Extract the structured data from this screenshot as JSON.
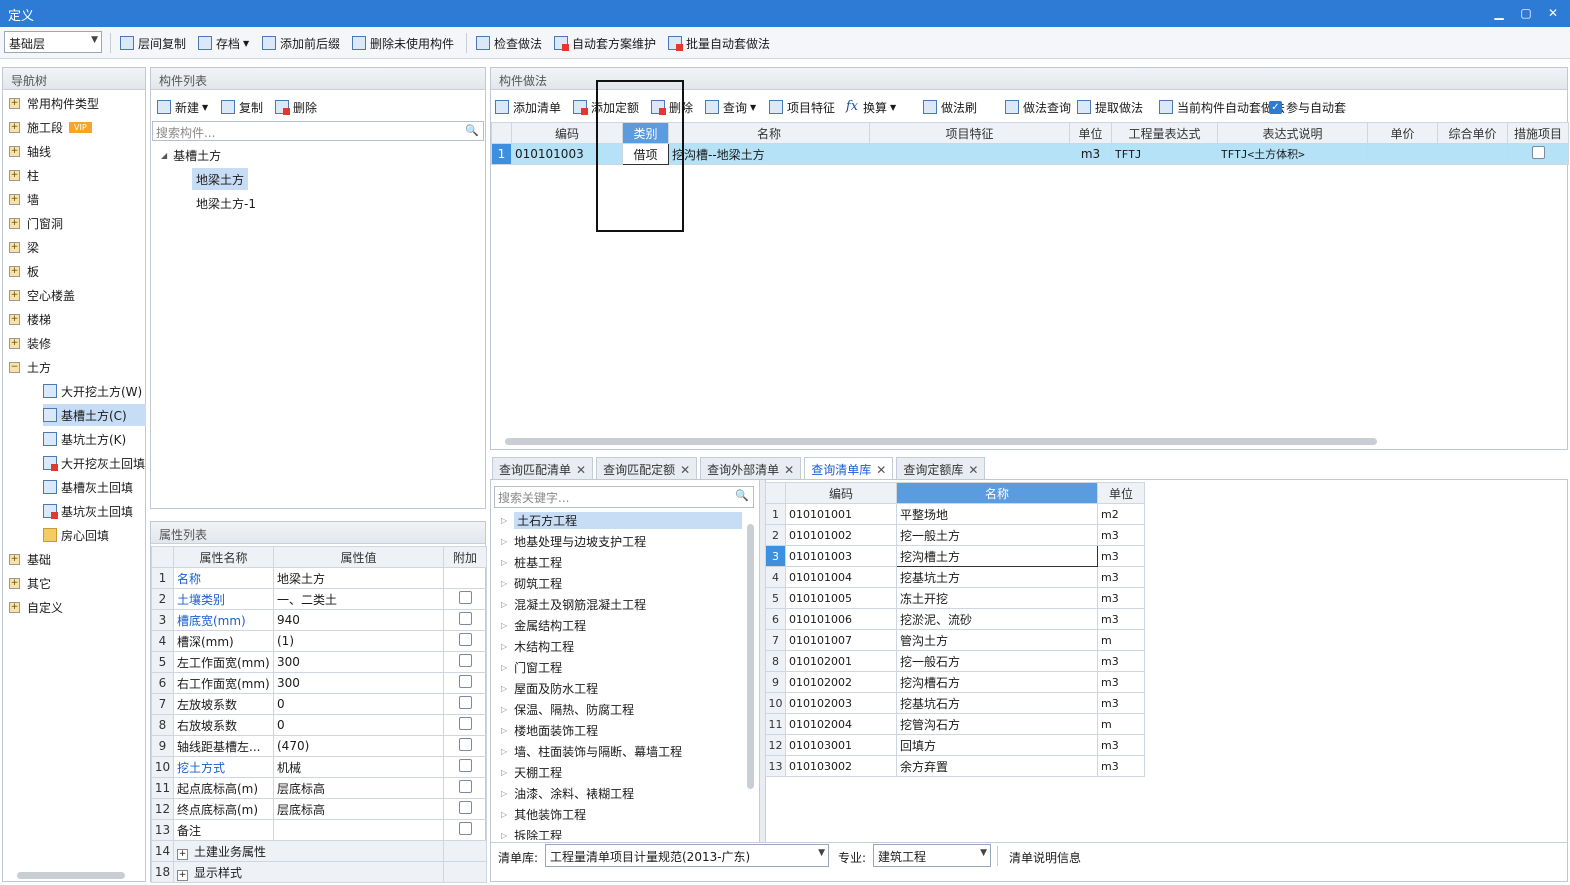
{
  "window": {
    "title": "定义",
    "min": "▁",
    "max": "▢",
    "close": "✕"
  },
  "toolbar": {
    "floor_select": "基础层",
    "buttons": [
      "层间复制",
      "存档",
      "添加前后缀",
      "删除未使用构件",
      "检查做法",
      "自动套方案维护",
      "批量自动套做法"
    ]
  },
  "nav": {
    "header": "导航树",
    "vip": "VIP",
    "items": [
      "常用构件类型",
      "施工段",
      "轴线",
      "柱",
      "墙",
      "门窗洞",
      "梁",
      "板",
      "空心楼盖",
      "楼梯",
      "装修",
      "土方"
    ],
    "earth_children": [
      "大开挖土方(W)",
      "基槽土方(C)",
      "基坑土方(K)",
      "大开挖灰土回填",
      "基槽灰土回填",
      "基坑灰土回填",
      "房心回填"
    ],
    "after": [
      "基础",
      "其它",
      "自定义"
    ]
  },
  "comp_list": {
    "header": "构件列表",
    "new": "新建",
    "copy": "复制",
    "delete": "删除",
    "search_placeholder": "搜索构件...",
    "group": "基槽土方",
    "items": [
      "地梁土方",
      "地梁土方-1"
    ]
  },
  "props": {
    "header": "属性列表",
    "cols": [
      "属性名称",
      "属性值",
      "附加"
    ],
    "rows": [
      {
        "n": "1",
        "name": "名称",
        "value": "地梁土方"
      },
      {
        "n": "2",
        "name": "土壤类别",
        "value": "一、二类土"
      },
      {
        "n": "3",
        "name": "槽底宽(mm)",
        "value": "940"
      },
      {
        "n": "4",
        "name": "槽深(mm)",
        "value": "(1)"
      },
      {
        "n": "5",
        "name": "左工作面宽(mm)",
        "value": "300"
      },
      {
        "n": "6",
        "name": "右工作面宽(mm)",
        "value": "300"
      },
      {
        "n": "7",
        "name": "左放坡系数",
        "value": "0"
      },
      {
        "n": "8",
        "name": "右放坡系数",
        "value": "0"
      },
      {
        "n": "9",
        "name": "轴线距基槽左...",
        "value": "(470)"
      },
      {
        "n": "10",
        "name": "挖土方式",
        "value": "机械"
      },
      {
        "n": "11",
        "name": "起点底标高(m)",
        "value": "层底标高"
      },
      {
        "n": "12",
        "name": "终点底标高(m)",
        "value": "层底标高"
      },
      {
        "n": "13",
        "name": "备注",
        "value": ""
      },
      {
        "n": "14",
        "name": "土建业务属性",
        "value": ""
      },
      {
        "n": "18",
        "name": "显示样式",
        "value": ""
      }
    ]
  },
  "method": {
    "header": "构件做法",
    "tools": [
      "添加清单",
      "添加定额",
      "删除",
      "查询",
      "项目特征",
      "换算",
      "做法刷",
      "做法查询",
      "提取做法",
      "当前构件自动套做法",
      "参与自动套"
    ],
    "cols": [
      "编码",
      "类别",
      "名称",
      "项目特征",
      "单位",
      "工程量表达式",
      "表达式说明",
      "单价",
      "综合单价",
      "措施项目"
    ],
    "row": {
      "n": "1",
      "code": "010101003",
      "type": "借项",
      "name": "挖沟槽--地梁土方",
      "feature": "",
      "unit": "m3",
      "expr": "TFTJ",
      "desc": "TFTJ<土方体积>",
      "price": "",
      "total": ""
    }
  },
  "query": {
    "tabs": [
      "查询匹配清单",
      "查询匹配定额",
      "查询外部清单",
      "查询清单库",
      "查询定额库"
    ],
    "search_placeholder": "搜索关键字...",
    "tree": [
      "土石方工程",
      "地基处理与边坡支护工程",
      "桩基工程",
      "砌筑工程",
      "混凝土及钢筋混凝土工程",
      "金属结构工程",
      "木结构工程",
      "门窗工程",
      "屋面及防水工程",
      "保温、隔热、防腐工程",
      "楼地面装饰工程",
      "墙、柱面装饰与隔断、幕墙工程",
      "天棚工程",
      "油漆、涂料、裱糊工程",
      "其他装饰工程",
      "拆除工程"
    ],
    "cols": [
      "编码",
      "名称",
      "单位"
    ],
    "rows": [
      [
        "1",
        "010101001",
        "平整场地",
        "m2"
      ],
      [
        "2",
        "010101002",
        "挖一般土方",
        "m3"
      ],
      [
        "3",
        "010101003",
        "挖沟槽土方",
        "m3"
      ],
      [
        "4",
        "010101004",
        "挖基坑土方",
        "m3"
      ],
      [
        "5",
        "010101005",
        "冻土开挖",
        "m3"
      ],
      [
        "6",
        "010101006",
        "挖淤泥、流砂",
        "m3"
      ],
      [
        "7",
        "010101007",
        "管沟土方",
        "m"
      ],
      [
        "8",
        "010102001",
        "挖一般石方",
        "m3"
      ],
      [
        "9",
        "010102002",
        "挖沟槽石方",
        "m3"
      ],
      [
        "10",
        "010102003",
        "挖基坑石方",
        "m3"
      ],
      [
        "11",
        "010102004",
        "挖管沟石方",
        "m"
      ],
      [
        "12",
        "010103001",
        "回填方",
        "m3"
      ],
      [
        "13",
        "010103002",
        "余方弃置",
        "m3"
      ]
    ],
    "footer": {
      "lib_label": "清单库:",
      "lib_value": "工程量清单项目计量规范(2013-广东)",
      "spec_label": "专业:",
      "spec_value": "建筑工程",
      "info": "清单说明信息"
    }
  }
}
